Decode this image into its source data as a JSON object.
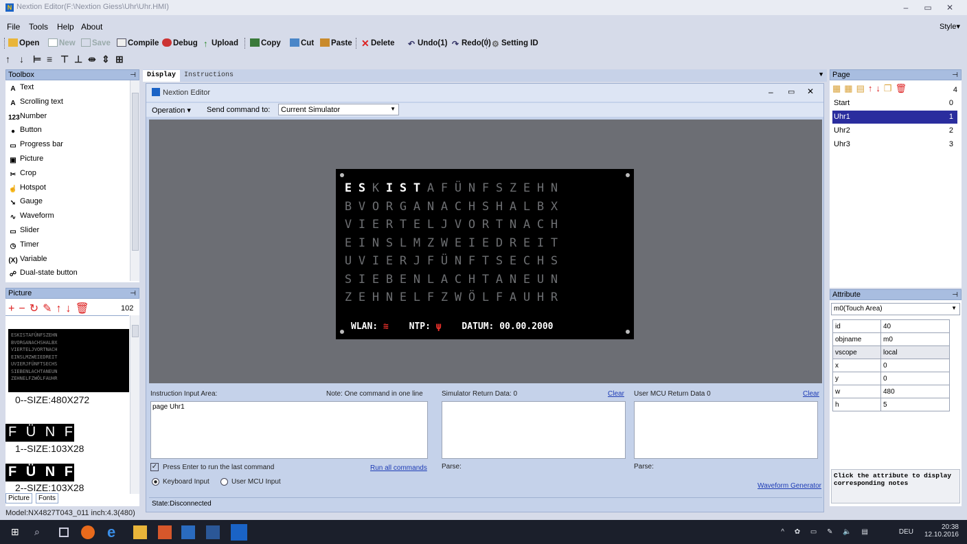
{
  "window": {
    "title": "Nextion Editor(F:\\Nextion Giess\\Uhr\\Uhr.HMI)",
    "min": "–",
    "max": "▭",
    "close": "✕"
  },
  "menu": {
    "items": [
      "File",
      "Tools",
      "Help",
      "About"
    ],
    "style": "Style▾"
  },
  "toolbar": {
    "open": "Open",
    "new": "New",
    "save": "Save",
    "compile": "Compile",
    "debug": "Debug",
    "upload": "Upload",
    "copy": "Copy",
    "cut": "Cut",
    "paste": "Paste",
    "delete": "Delete",
    "undo": "Undo(1)",
    "redo": "Redo(0)",
    "setting_id": "Setting ID"
  },
  "toolbox": {
    "title": "Toolbox",
    "items": [
      "Text",
      "Scrolling text",
      "Number",
      "Button",
      "Progress bar",
      "Picture",
      "Crop",
      "Hotspot",
      "Gauge",
      "Waveform",
      "Slider",
      "Timer",
      "Variable",
      "Dual-state button"
    ],
    "icon_glyphs": [
      "A",
      "A",
      "123",
      "●",
      "▭",
      "▣",
      "✂",
      "☝",
      "➘",
      "∿",
      "▭",
      "◷",
      "(X)",
      "☍"
    ]
  },
  "picture_panel": {
    "title": "Picture",
    "count": "102",
    "items": [
      {
        "preview": "ESKISTAFÜNFSZEHN",
        "label": "0--SIZE:480X272"
      },
      {
        "preview": "F Ü N F",
        "label": "1--SIZE:103X28"
      },
      {
        "preview": "F Ü N F",
        "label": "2--SIZE:103X28"
      }
    ],
    "tabs": [
      "Picture",
      "Fonts"
    ]
  },
  "model_line": "Model:NX4827T043_011  inch:4.3(480)",
  "doc_tabs": [
    "Display",
    "Instructions"
  ],
  "nextion": {
    "title": "Nextion Editor",
    "operation": "Operation ▾",
    "send_label": "Send command to:",
    "send_value": "Current Simulator"
  },
  "lcd": {
    "rows": [
      "ESKISTAFÜNFSZEHN",
      "BVORGANACHSHALBX",
      "VIERTELJVORTNACH",
      "EINSLMZWEIEDREIT",
      "UVIERJFÜNFTSECHS",
      "SIEBENLACHTANEUN",
      "ZEHNELFZWÖLFAUHR"
    ],
    "highlight": [
      0,
      1,
      3,
      4,
      5
    ],
    "wlan": "WLAN:",
    "ntp": "NTP:",
    "datum": "DATUM: 00.00.2000",
    "wifi_color": "#e8302a"
  },
  "io": {
    "instr_label": "Instruction Input Area:",
    "note": "Note: One command in one line",
    "instr_value": "page Uhr1",
    "sim_label": "Simulator Return Data:  0",
    "mcu_label": "User MCU Return Data  0",
    "clear": "Clear",
    "press_enter": "Press Enter to run the last command",
    "run_all": "Run all commands",
    "parse": "Parse:",
    "keyboard": "Keyboard Input",
    "user_mcu": "User MCU Input",
    "waveform": "Waveform Generator",
    "state": "State:Disconnected"
  },
  "page_panel": {
    "title": "Page",
    "count": "4",
    "pages": [
      {
        "name": "Start",
        "id": "0"
      },
      {
        "name": "Uhr1",
        "id": "1"
      },
      {
        "name": "Uhr2",
        "id": "2"
      },
      {
        "name": "Uhr3",
        "id": "3"
      }
    ],
    "selected": 1
  },
  "attribute_panel": {
    "title": "Attribute",
    "selected": "m0(Touch Area)",
    "rows": [
      [
        "id",
        "40"
      ],
      [
        "objname",
        "m0"
      ],
      [
        "vscope",
        "local"
      ],
      [
        "x",
        "0"
      ],
      [
        "y",
        "0"
      ],
      [
        "w",
        "480"
      ],
      [
        "h",
        "5"
      ]
    ],
    "note": "Click the attribute to display corresponding notes"
  },
  "tray": {
    "lang": "DEU",
    "time": "20:38",
    "date": "12.10.2016"
  },
  "colors": {
    "accent": "#2a2d9e",
    "lcd_bg": "#000000",
    "canvas": "#6c6e74"
  }
}
